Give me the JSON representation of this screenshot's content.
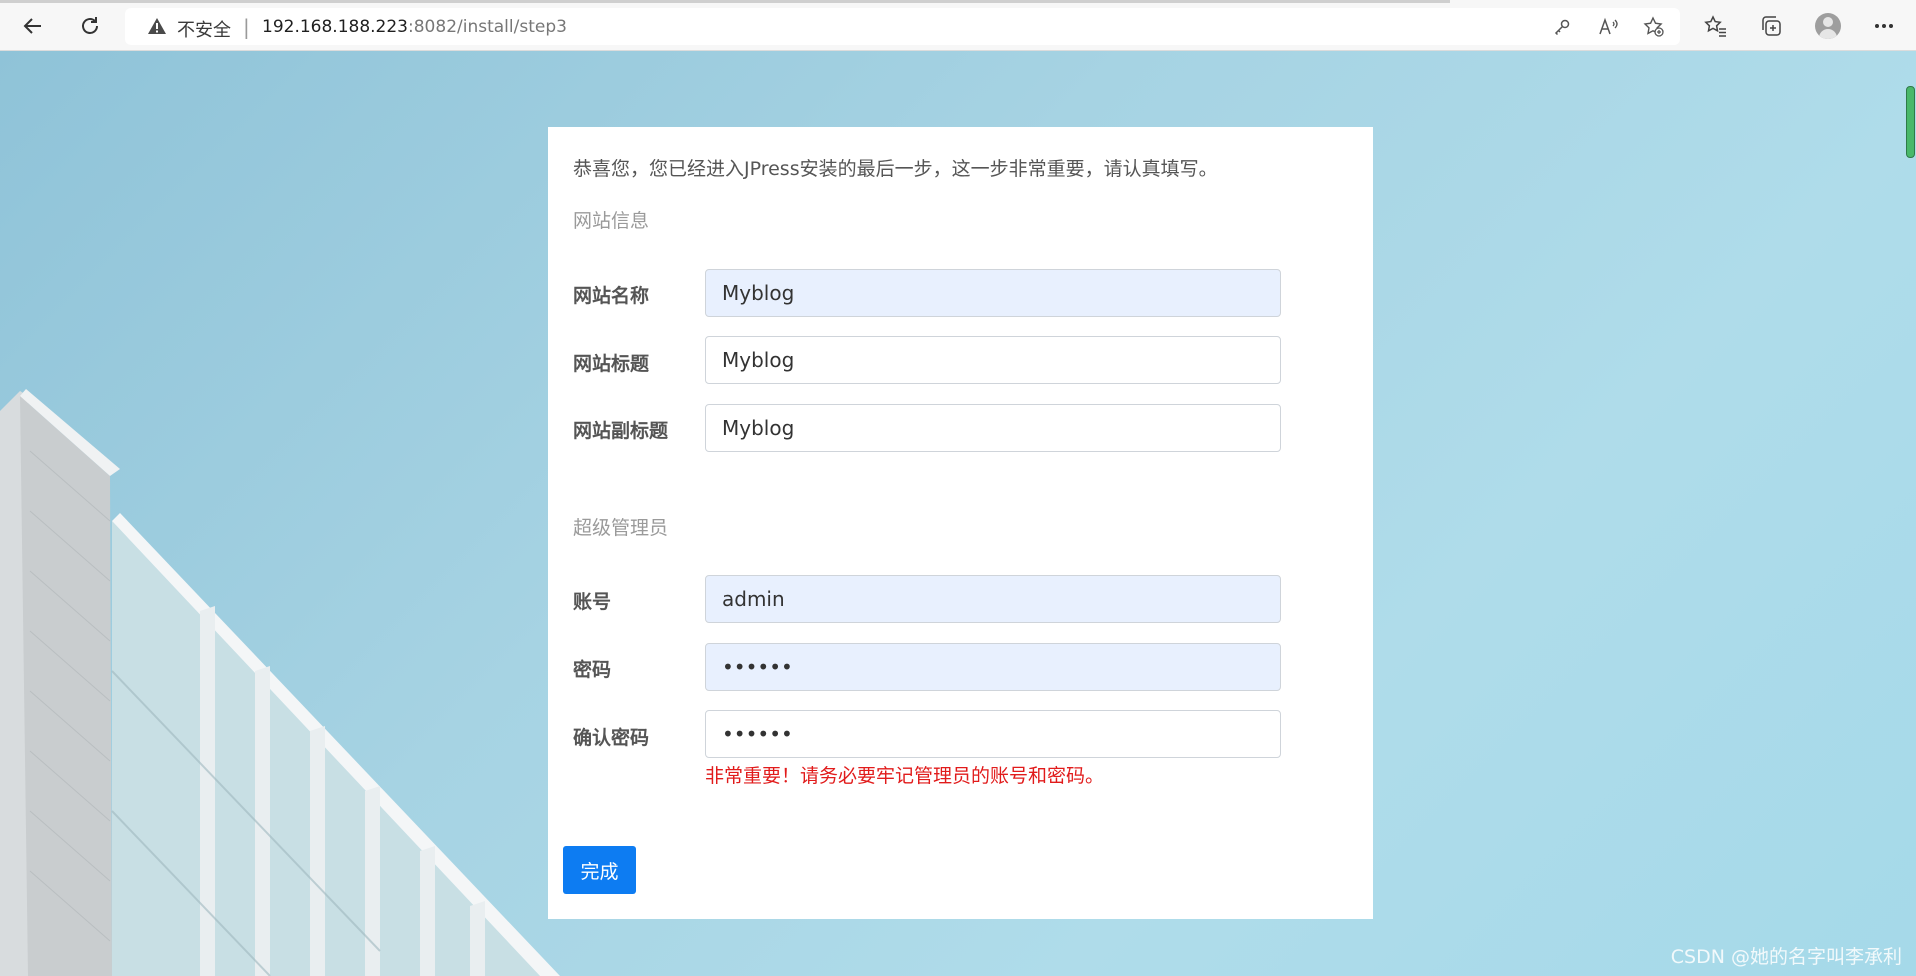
{
  "browser": {
    "security_label": "不安全",
    "separator": "|",
    "url_host": "192.168.188.223",
    "url_path": ":8082/install/step3"
  },
  "page": {
    "intro": "恭喜您，您已经进入JPress安装的最后一步，这一步非常重要，请认真填写。",
    "site_section_title": "网站信息",
    "site_fields": [
      {
        "label": "网站名称",
        "value": "Myblog"
      },
      {
        "label": "网站标题",
        "value": "Myblog"
      },
      {
        "label": "网站副标题",
        "value": "Myblog"
      }
    ],
    "admin_section_title": "超级管理员",
    "admin_fields": [
      {
        "label": "账号",
        "value": "admin"
      },
      {
        "label": "密码",
        "value": "123456"
      },
      {
        "label": "确认密码",
        "value": "123456"
      }
    ],
    "warning": "非常重要！请务必要牢记管理员的账号和密码。",
    "submit_label": "完成"
  },
  "watermark": "CSDN @她的名字叫李承利",
  "colors": {
    "accent": "#0d7cf2",
    "error": "#e11b1b",
    "autofill": "#e8f0fe"
  }
}
